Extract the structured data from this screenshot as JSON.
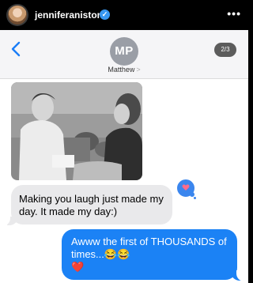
{
  "instagram": {
    "username": "jenniferaniston",
    "verified_mark": "✓",
    "more_label": "•••"
  },
  "conversation": {
    "contact_initials": "MP",
    "contact_name": "Matthew",
    "contact_chevron": ">",
    "page_indicator": "2/3"
  },
  "messages": {
    "received": "Making you laugh just made my day. It made my day:)",
    "sent_text": "Awww the first of THOUSANDS of times...",
    "sent_emoji": "😂😂",
    "sent_heart": "❤️"
  },
  "colors": {
    "sent_bubble": "#1b82f5",
    "received_bubble": "#e9e9eb",
    "tapback": "#3b86ee",
    "ios_blue": "#1a7df7"
  },
  "icons": [
    "back-chevron-icon",
    "heart-tapback-icon",
    "verified-badge-icon",
    "more-options-icon"
  ]
}
